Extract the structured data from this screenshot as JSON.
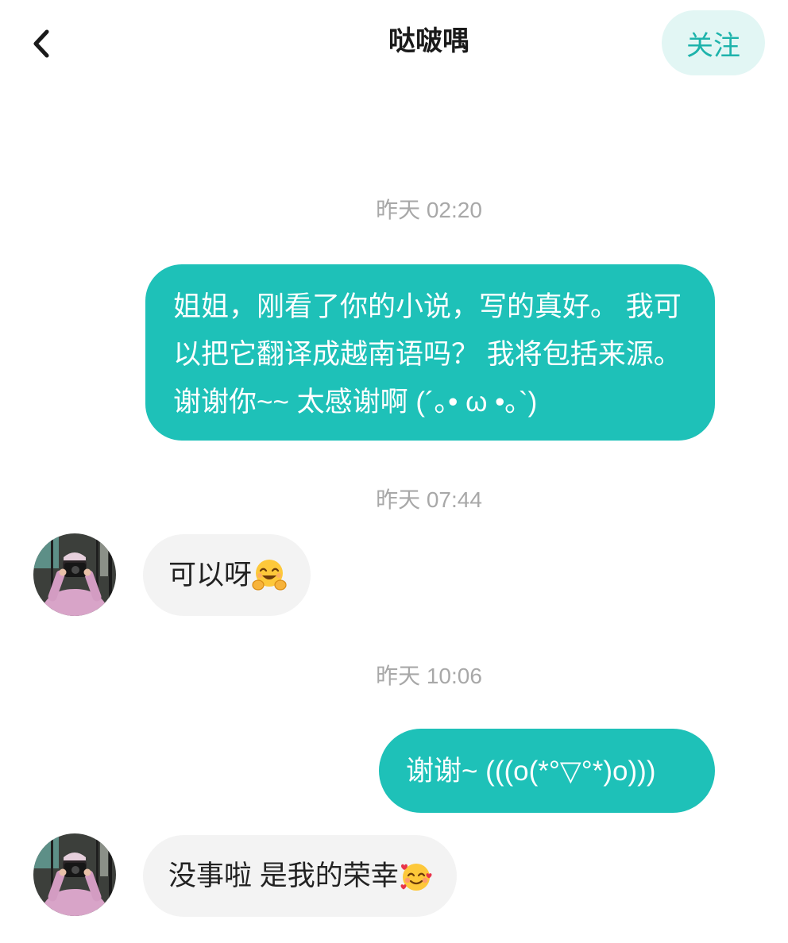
{
  "header": {
    "back_icon": "chevron-left-icon",
    "title": "哒啵喁",
    "follow_label": "关注"
  },
  "colors": {
    "accent": "#1ec1b8",
    "follow_bg": "#e2f6f4",
    "follow_text": "#1db3ab",
    "incoming_bg": "#f3f3f3",
    "timestamp": "#a8a8a8",
    "text": "#222222"
  },
  "chat": {
    "groups": [
      {
        "timestamp": "昨天 02:20",
        "messages": [
          {
            "outgoing": true,
            "text": "姐姐，刚看了你的小说，写的真好。 我可以把它翻译成越南语吗？ 我将包括来源。 谢谢你~~ 太感谢啊 (´｡• ω •｡`)"
          }
        ]
      },
      {
        "timestamp": "昨天 07:44",
        "messages": [
          {
            "outgoing": false,
            "avatar_icon": "avatar-photo",
            "text": "可以呀",
            "emoji_icon": "hugging-face-emoji"
          }
        ]
      },
      {
        "timestamp": "昨天 10:06",
        "messages": [
          {
            "outgoing": true,
            "text": "谢谢~ (((o(*°▽°*)o)))"
          },
          {
            "outgoing": false,
            "avatar_icon": "avatar-photo",
            "text": "没事啦 是我的荣幸",
            "emoji_icon": "smiling-face-with-hearts-emoji"
          }
        ]
      }
    ]
  }
}
